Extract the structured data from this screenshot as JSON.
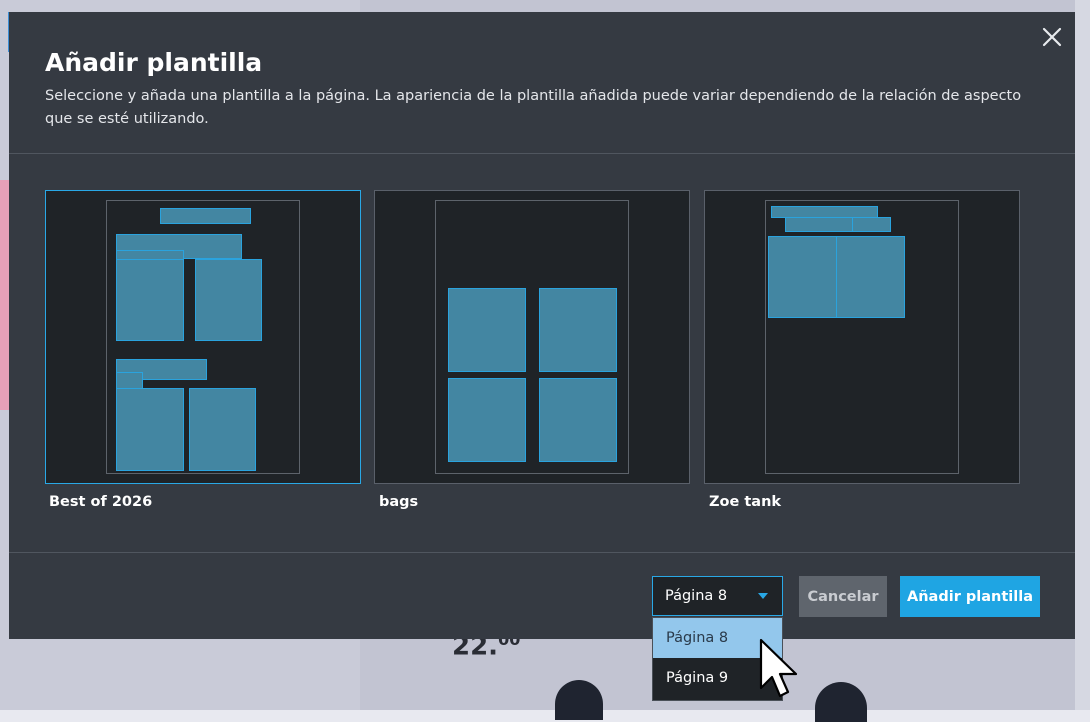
{
  "background": {
    "price_main": "22.",
    "price_cents": "00"
  },
  "modal": {
    "title": "Añadir plantilla",
    "subtitle": "Seleccione y añada una plantilla a la página. La apariencia de la plantilla añadida puede variar dependiendo de la relación de aspecto que se esté utilizando.",
    "close_icon": "close-icon"
  },
  "templates": [
    {
      "label": "Best of 2026",
      "selected": true
    },
    {
      "label": "bags",
      "selected": false
    },
    {
      "label": "Zoe tank",
      "selected": false
    }
  ],
  "footer": {
    "page_select_value": "Página 8",
    "page_options": [
      "Página 8",
      "Página 9"
    ],
    "highlighted_option": "Página 8",
    "cancel_label": "Cancelar",
    "add_label": "Añadir plantilla"
  },
  "colors": {
    "accent": "#1fa5e3",
    "modal_bg": "#353a42",
    "card_bg": "#1f2327",
    "block_fill": "#4386a2"
  }
}
